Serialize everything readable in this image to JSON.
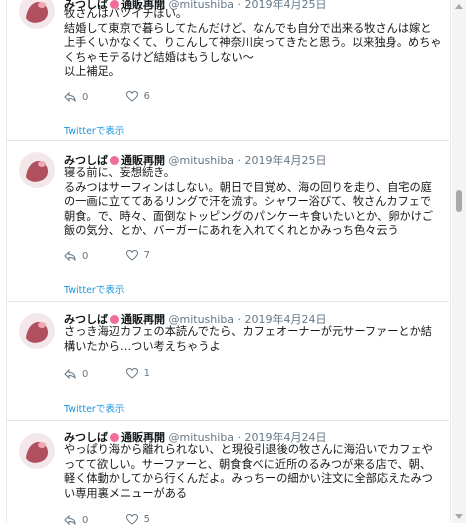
{
  "tweets": [
    {
      "name": "みつしば",
      "badge_text": "通販再開",
      "handle": "@mitushiba",
      "date": "2019年4月25日",
      "text": "牧さんはバツイチぽい。\n結婚して東京で暮らしてたんだけど、なんでも自分で出来る牧さんは嫁と上手くいかなくて、りこんして神奈川戻ってきたと思う。以来独身。めちゃくちゃモテるけど結婚はもうしない〜\n以上補足。",
      "replies": "0",
      "likes": "6",
      "twitter_link": "Twitterで表示"
    },
    {
      "name": "みつしば",
      "badge_text": "通販再開",
      "handle": "@mitushiba",
      "date": "2019年4月25日",
      "text": "寝る前に、妄想続き。\nるみつはサーフィンはしない。朝日で目覚め、海の回りを走り、自宅の庭の一画に立ててあるリングで汗を流す。シャワー浴びて、牧さんカフェで朝食。で、時々、面倒なトッピングのパンケーキ食いたいとか、卵かけご飯の気分、とか、バーガーにあれを入れてくれとかみっち色々云う",
      "replies": "0",
      "likes": "7",
      "twitter_link": "Twitterで表示"
    },
    {
      "name": "みつしば",
      "badge_text": "通販再開",
      "handle": "@mitushiba",
      "date": "2019年4月24日",
      "text": "さっき海辺カフェの本読んでたら、カフェオーナーが元サーファーとか結構いたから…つい考えちゃうよ",
      "replies": "0",
      "likes": "1",
      "twitter_link": "Twitterで表示"
    },
    {
      "name": "みつしば",
      "badge_text": "通販再開",
      "handle": "@mitushiba",
      "date": "2019年4月24日",
      "text": "やっぱり海から離れられない、と現役引退後の牧さんに海沿いでカフェやってて欲しい。サーファーと、朝食食べに近所のるみつが来る店で、朝、軽く体動かしてから行くんだよ。みっちーの細かい注文に全部応えたみつい専用裏メニューがある",
      "replies": "0",
      "likes": "5",
      "twitter_link": ""
    }
  ],
  "colors": {
    "link": "#1b95e0",
    "muted": "#657786",
    "badge": "#f26b9a"
  }
}
